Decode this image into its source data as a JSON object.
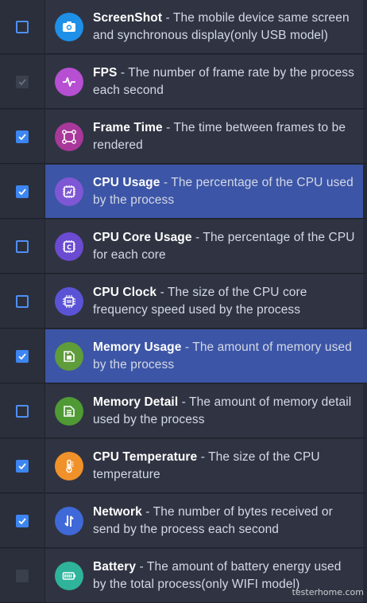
{
  "metrics": [
    {
      "title": "ScreenShot",
      "desc": " - The mobile device same screen and synchronous display(only USB model)",
      "icon": "camera-icon",
      "color": "#1e90e8",
      "state": "unchecked"
    },
    {
      "title": "FPS",
      "desc": " - The number of frame rate by the process each second",
      "icon": "pulse-icon",
      "color": "#b74fd2",
      "state": "disabled-checked"
    },
    {
      "title": "Frame Time",
      "desc": " - The time between frames to be rendered",
      "icon": "nodes-icon",
      "color": "#a8389a",
      "state": "checked"
    },
    {
      "title": "CPU Usage",
      "desc": " - The percentage of the CPU used by the process",
      "icon": "cpu-chart-icon",
      "color": "#7e57d4",
      "state": "checked",
      "highlight": true
    },
    {
      "title": "CPU Core Usage",
      "desc": " - The percentage of the CPU for each core",
      "icon": "cpu-core-icon",
      "color": "#6a4bd1",
      "state": "unchecked"
    },
    {
      "title": "CPU Clock",
      "desc": " - The size of the CPU core frequency speed used by the process",
      "icon": "cpu-clock-icon",
      "color": "#5b53d6",
      "state": "unchecked"
    },
    {
      "title": "Memory Usage",
      "desc": " - The amount of memory used by the process",
      "icon": "memory-icon",
      "color": "#5f9c3a",
      "state": "checked",
      "highlight": true
    },
    {
      "title": "Memory Detail",
      "desc": " - The amount of memory detail used by the process",
      "icon": "memory-detail-icon",
      "color": "#4f9a35",
      "state": "unchecked"
    },
    {
      "title": "CPU Temperature",
      "desc": " - The size of the CPU temperature",
      "icon": "thermometer-icon",
      "color": "#f0912a",
      "state": "checked"
    },
    {
      "title": "Network",
      "desc": " - The number of bytes received or send by the process each second",
      "icon": "network-icon",
      "color": "#3f69d8",
      "state": "checked"
    },
    {
      "title": "Battery",
      "desc": " - The amount of battery energy used by the total process(only WIFI model)",
      "icon": "battery-icon",
      "color": "#2fb39a",
      "state": "disabled"
    }
  ],
  "watermark": "testerhome.com"
}
